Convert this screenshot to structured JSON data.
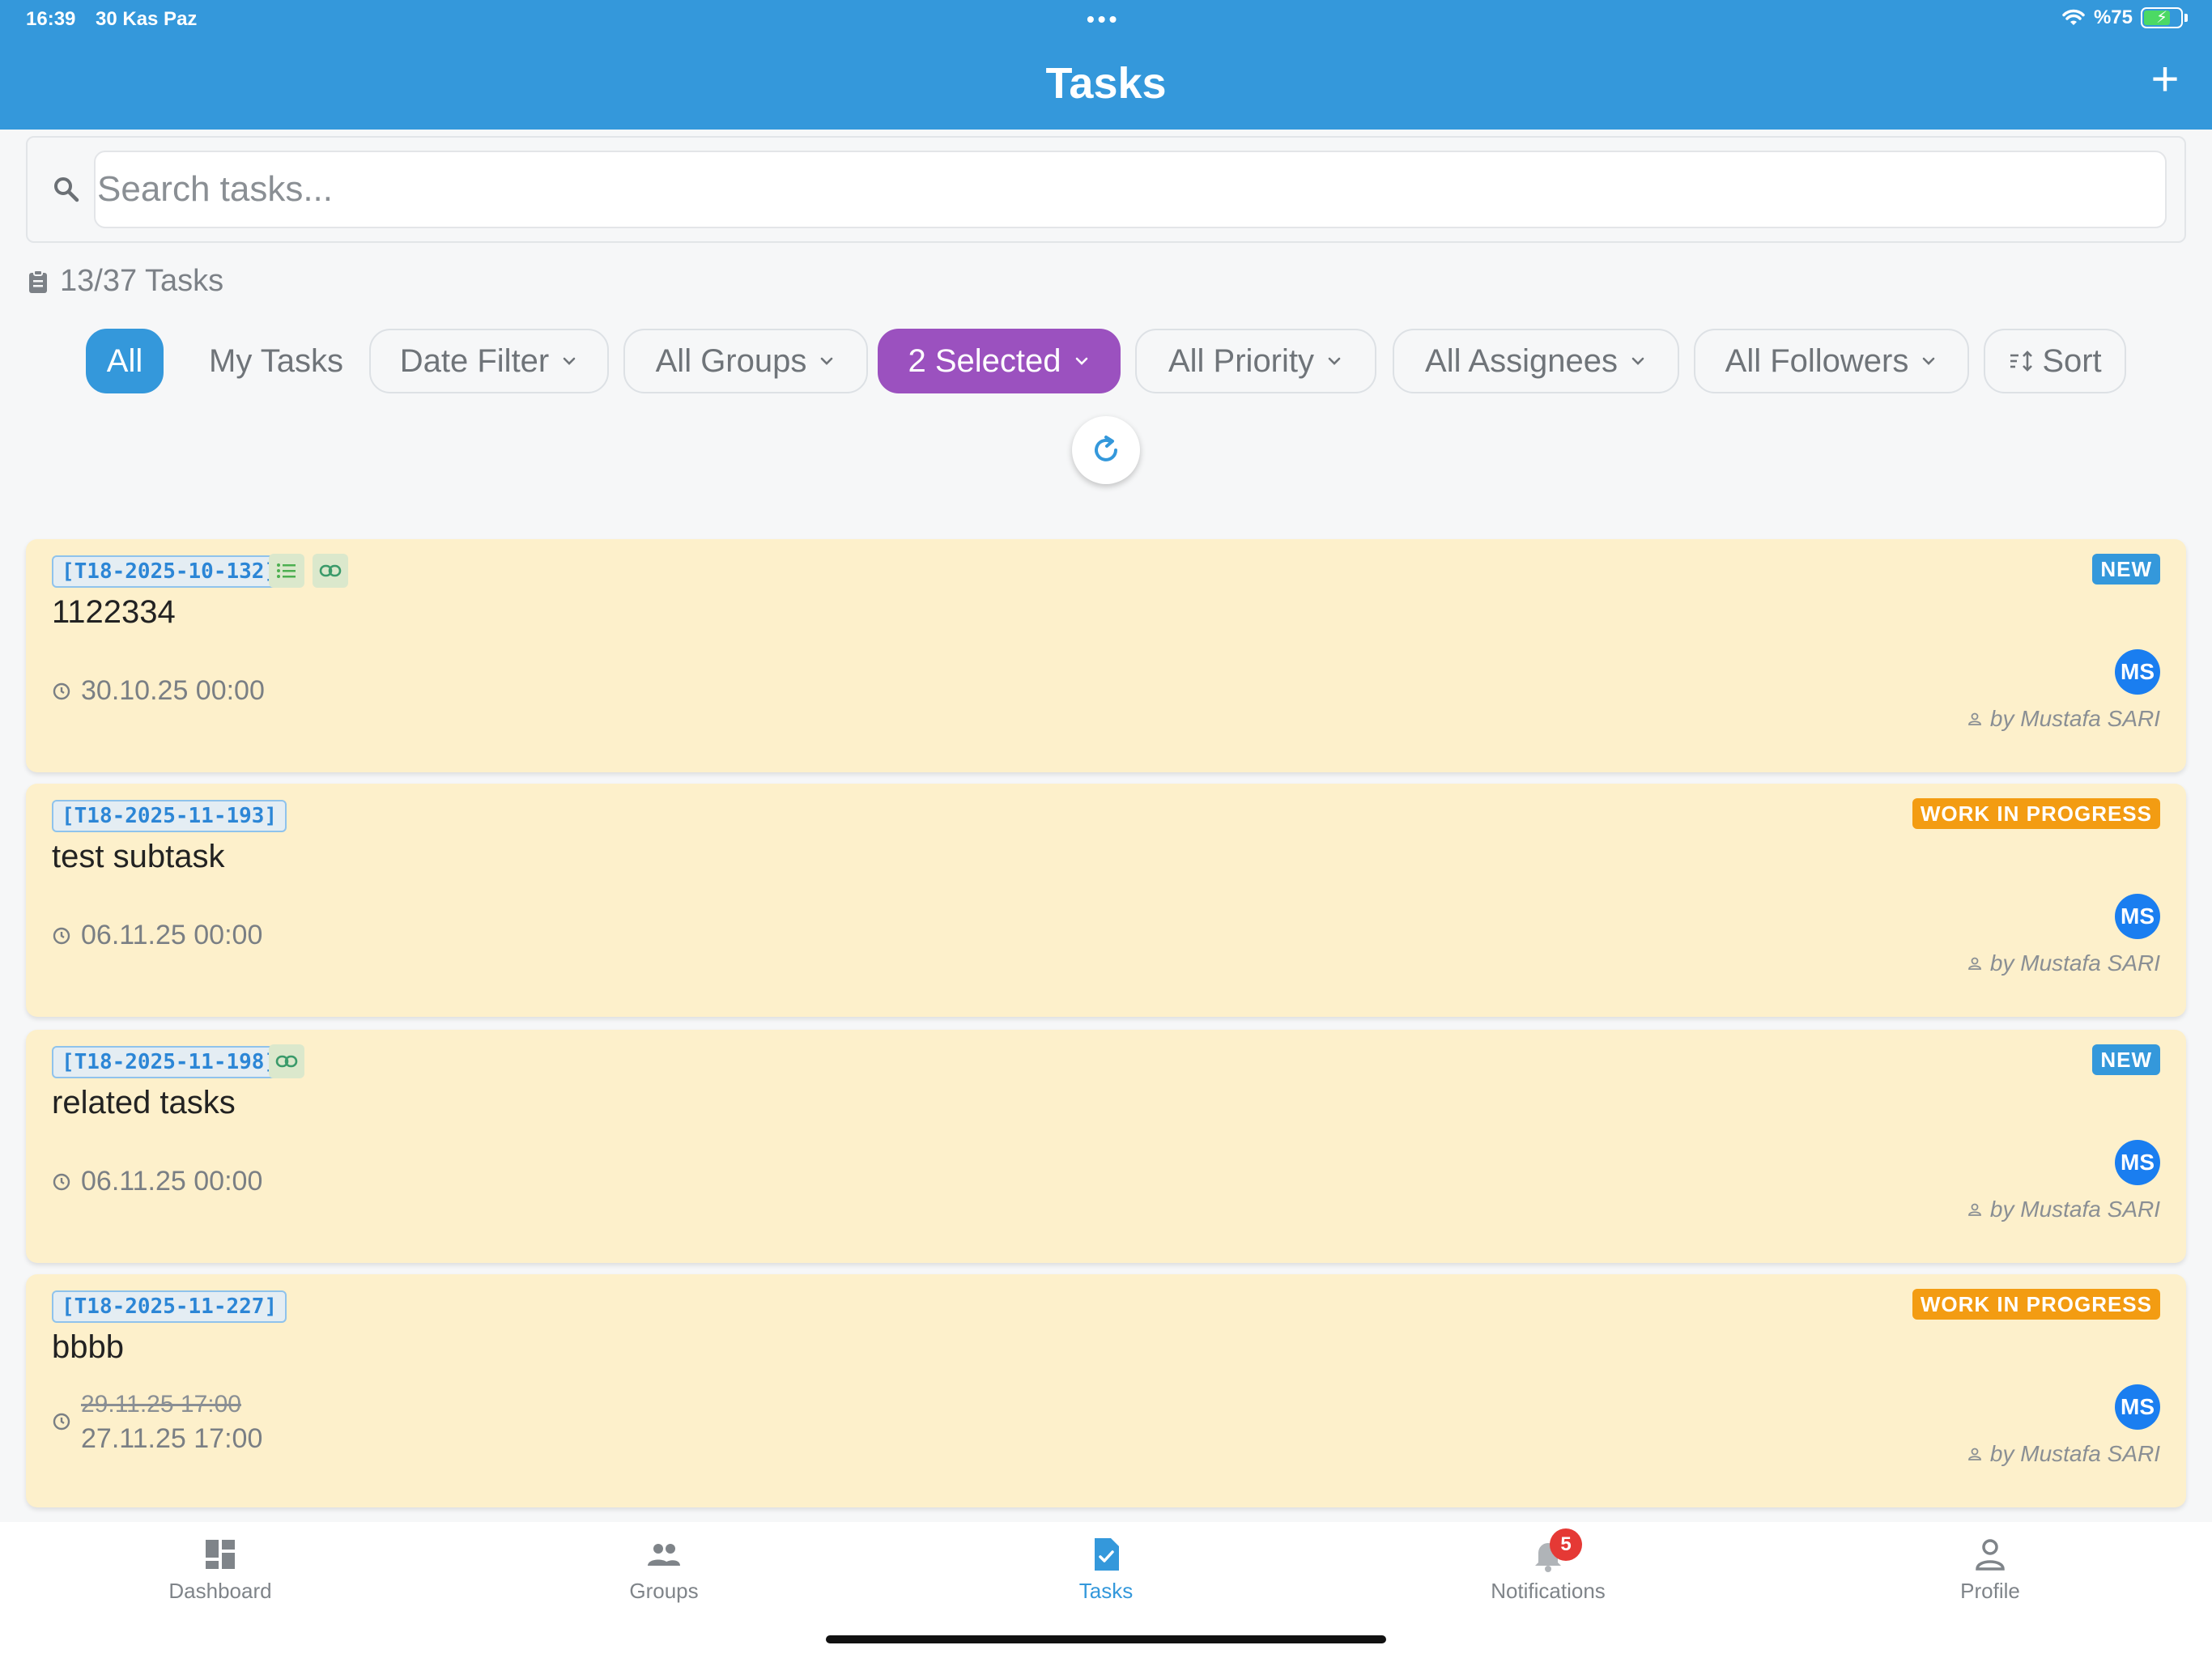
{
  "status_bar": {
    "time": "16:39",
    "date": "30 Kas Paz",
    "battery": "%75",
    "battery_level": 0.75
  },
  "header": {
    "title": "Tasks",
    "add_label": "+"
  },
  "search": {
    "placeholder": "Search tasks..."
  },
  "task_count": "13/37 Tasks",
  "filters": {
    "all": "All",
    "my_tasks": "My Tasks",
    "date_filter": "Date Filter",
    "groups": "All Groups",
    "status": "2 Selected",
    "priority": "All Priority",
    "assignees": "All Assignees",
    "followers": "All Followers",
    "sort": "Sort"
  },
  "tasks": [
    {
      "id": "[T18-2025-10-132]",
      "title": "1122334",
      "due": "30.10.25 00:00",
      "status": "NEW",
      "assignee_initials": "MS",
      "creator": "by Mustafa SARI",
      "has_subtasks": true,
      "has_links": true
    },
    {
      "id": "[T18-2025-11-193]",
      "title": "test subtask",
      "due": "06.11.25 00:00",
      "status": "WORK IN PROGRESS",
      "assignee_initials": "MS",
      "creator": "by Mustafa SARI"
    },
    {
      "id": "[T18-2025-11-198]",
      "title": "related tasks",
      "due": "06.11.25 00:00",
      "status": "NEW",
      "assignee_initials": "MS",
      "creator": "by Mustafa SARI",
      "has_links": true
    },
    {
      "id": "[T18-2025-11-227]",
      "title": "bbbb",
      "due_old": "29.11.25 17:00",
      "due": "27.11.25 17:00",
      "status": "WORK IN PROGRESS",
      "assignee_initials": "MS",
      "creator": "by Mustafa SARI"
    }
  ],
  "nav": {
    "dashboard": "Dashboard",
    "groups": "Groups",
    "tasks": "Tasks",
    "notifications": "Notifications",
    "notifications_badge": "5",
    "profile": "Profile"
  },
  "colors": {
    "header": "#3498db",
    "card_bg": "#fdf0cb",
    "status_new": "#3498db",
    "status_wip": "#f39c12",
    "selected_filter": "#9b51bf",
    "avatar": "#1a7ef0"
  }
}
